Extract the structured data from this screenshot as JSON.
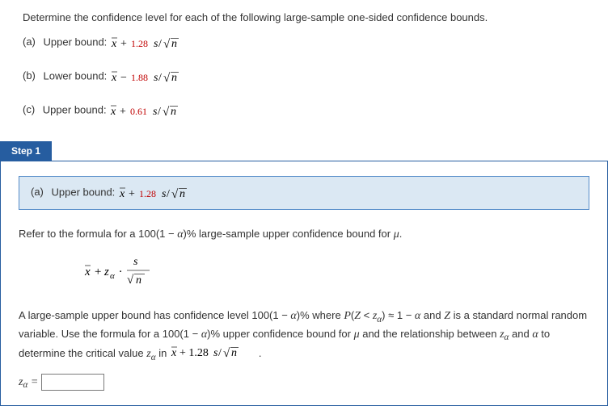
{
  "question": {
    "prompt": "Determine the confidence level for each of the following large-sample one-sided confidence bounds.",
    "parts": {
      "a": {
        "label": "(a)",
        "bound_text": "Upper bound: ",
        "z_value": "1.28",
        "sign": "+"
      },
      "b": {
        "label": "(b)",
        "bound_text": "Lower bound: ",
        "z_value": "1.88",
        "sign": "−"
      },
      "c": {
        "label": "(c)",
        "bound_text": "Upper bound: ",
        "z_value": "0.61",
        "sign": "+"
      }
    }
  },
  "step1": {
    "tab_label": "Step 1",
    "sub_a": {
      "label": "(a)",
      "bound_text": "Upper bound: ",
      "z_value": "1.28",
      "sign": "+"
    },
    "refer_text": "Refer to the formula for a 100(1 − α)% large-sample upper confidence bound for μ.",
    "explain_text": "A large-sample upper bound has confidence level 100(1 − α)% where P(Z < zα) ≈ 1 − α and Z is a standard normal random variable. Use the formula for a 100(1 − α)% upper confidence bound for μ and the relationship between zα and α to determine the critical value zα in x̄ + 1.28s/√n.",
    "z_alpha_label": "zα = ",
    "input_value": ""
  }
}
